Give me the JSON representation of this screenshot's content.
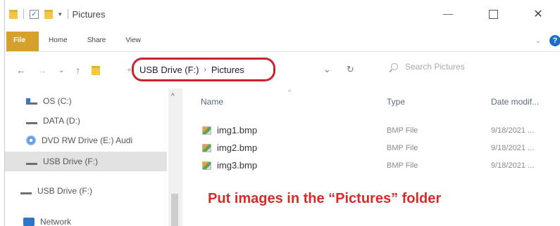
{
  "window": {
    "title": "Pictures",
    "close_glyph": "✕"
  },
  "ribbon": {
    "tabs": [
      "File",
      "Home",
      "Share",
      "View"
    ],
    "help_glyph": "?"
  },
  "address_bar": {
    "back_glyph": "←",
    "forward_glyph": "→",
    "recent_glyph": "⌄",
    "up_glyph": "↑",
    "prefix_glyph": "«",
    "path": [
      "USB Drive (F:)",
      "Pictures"
    ],
    "separator": "›",
    "history_glyph": "⌄",
    "refresh_glyph": "↻",
    "search_placeholder": "Search Pictures"
  },
  "nav_pane": {
    "items": [
      {
        "label": "OS (C:)",
        "icon": "os-drive-icon",
        "selected": false
      },
      {
        "label": "DATA (D:)",
        "icon": "drive-icon",
        "selected": false
      },
      {
        "label": "DVD RW Drive (E:) Audi",
        "icon": "dvd-drive-icon",
        "selected": false
      },
      {
        "label": "USB Drive (F:)",
        "icon": "usb-drive-icon",
        "selected": true
      },
      {
        "label": "USB Drive (F:)",
        "icon": "usb-drive-icon",
        "selected": false
      },
      {
        "label": "Network",
        "icon": "network-icon",
        "selected": false
      }
    ]
  },
  "file_list": {
    "columns": {
      "name": "Name",
      "type": "Type",
      "date": "Date modif..."
    },
    "files": [
      {
        "name": "img1.bmp",
        "type": "BMP File",
        "date": "9/18/2021 ..."
      },
      {
        "name": "img2.bmp",
        "type": "BMP File",
        "date": "9/18/2021 ..."
      },
      {
        "name": "img3.bmp",
        "type": "BMP File",
        "date": "9/18/2021 ..."
      }
    ]
  },
  "annotation": {
    "text": "Put images in the “Pictures” folder",
    "color": "#d52b2b",
    "highlight_color": "#c8242b"
  }
}
